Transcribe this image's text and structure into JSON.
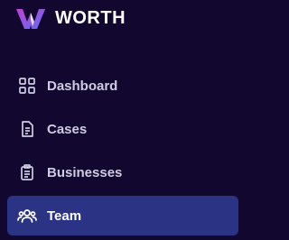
{
  "brand": {
    "name": "WORTH",
    "logo_icon": "worth-logo-icon"
  },
  "colors": {
    "background": "#12082f",
    "active_item_bg": "#2b3484",
    "text": "#cfcde3",
    "text_active": "#ffffff",
    "logo_gradient_start": "#b23bd6",
    "logo_gradient_end": "#6a6cf0"
  },
  "nav": {
    "items": [
      {
        "label": "Dashboard",
        "icon": "dashboard-grid-icon",
        "active": false
      },
      {
        "label": "Cases",
        "icon": "document-icon",
        "active": false
      },
      {
        "label": "Businesses",
        "icon": "clipboard-icon",
        "active": false
      },
      {
        "label": "Team",
        "icon": "team-users-icon",
        "active": true
      }
    ]
  }
}
